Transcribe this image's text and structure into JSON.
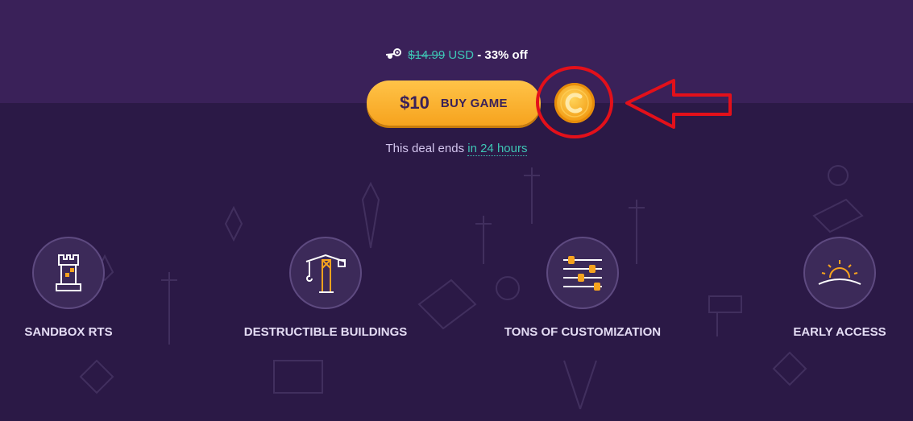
{
  "pricing": {
    "original_price": "$14.99",
    "currency": "USD",
    "discount_text": "- 33% off",
    "price": "$10",
    "buy_label": "BUY GAME",
    "deal_prefix": "This deal ends",
    "deal_time": "in 24 hours"
  },
  "features": [
    {
      "title": "SANDBOX RTS",
      "icon": "castle-tower-icon"
    },
    {
      "title": "DESTRUCTIBLE BUILDINGS",
      "icon": "crane-icon"
    },
    {
      "title": "TONS OF CUSTOMIZATION",
      "icon": "sliders-icon"
    },
    {
      "title": "EARLY ACCESS",
      "icon": "sunrise-icon"
    }
  ],
  "colors": {
    "accent_teal": "#3ec6b5",
    "button_gold": "#f6a31e",
    "background_purple": "#2a1845",
    "annotation_red": "#e3101a"
  }
}
